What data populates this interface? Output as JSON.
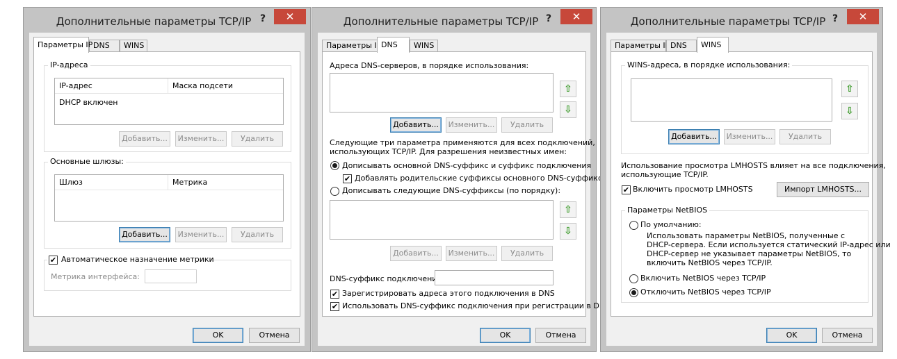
{
  "dialog_title": "Дополнительные параметры TCP/IP",
  "help_symbol": "?",
  "close_symbol": "✕",
  "tabs": {
    "ip": "Параметры IP",
    "dns": "DNS",
    "wins": "WINS"
  },
  "buttons": {
    "add": "Добавить...",
    "edit": "Изменить...",
    "remove": "Удалить",
    "ok": "OK",
    "cancel": "Отмена"
  },
  "ip": {
    "ip_group": "IP-адреса",
    "col_ip": "IP-адрес",
    "col_mask": "Маска подсети",
    "row_text": "DHCP включен",
    "gateways_group": "Основные шлюзы:",
    "col_gateway": "Шлюз",
    "col_metric": "Метрика",
    "auto_metric": "Автоматическое назначение метрики",
    "iface_metric": "Метрика интерфейса:"
  },
  "dns": {
    "servers_label": "Адреса DNS-серверов, в порядке использования:",
    "info_line1": "Следующие три параметра применяются для всех подключений,",
    "info_line2": "использующих TCP/IP. Для разрешения неизвестных имен:",
    "radio_primary": "Дописывать основной DNS-суффикс и суффикс подключения",
    "check_parent": "Добавлять родительские суффиксы основного DNS-суффикса",
    "radio_list": "Дописывать следующие DNS-суффиксы (по порядку):",
    "suffix_label": "DNS-суффикс подключения:",
    "register": "Зарегистрировать адреса этого подключения в DNS",
    "use_suffix": "Использовать DNS-суффикс подключения при регистрации в DNS"
  },
  "wins": {
    "addresses_label": "WINS-адреса, в порядке использования:",
    "lmhosts_line1": "Использование просмотра LMHOSTS влияет на все подключения,",
    "lmhosts_line2": "использующие TCP/IP.",
    "lmhosts_check": "Включить просмотр LMHOSTS",
    "import_button": "Импорт LMHOSTS...",
    "netbios_group": "Параметры NetBIOS",
    "default_radio": "По умолчанию:",
    "default_desc1": "Использовать параметры NetBIOS, полученные с",
    "default_desc2": "DHCP-сервера. Если используется статический IP-адрес или",
    "default_desc3": "DHCP-сервер не указывает параметры NetBIOS, то",
    "default_desc4": "включить NetBIOS через TCP/IP.",
    "enable_radio": "Включить NetBIOS через TCP/IP",
    "disable_radio": "Отключить NetBIOS через TCP/IP"
  },
  "icons": {
    "up": "arrow-up-icon",
    "down": "arrow-down-icon",
    "check_mark": "✔"
  },
  "colors": {
    "close_button": "#c7483a",
    "frame": "#c4c4c4",
    "arrow": "#3c9a2a"
  }
}
